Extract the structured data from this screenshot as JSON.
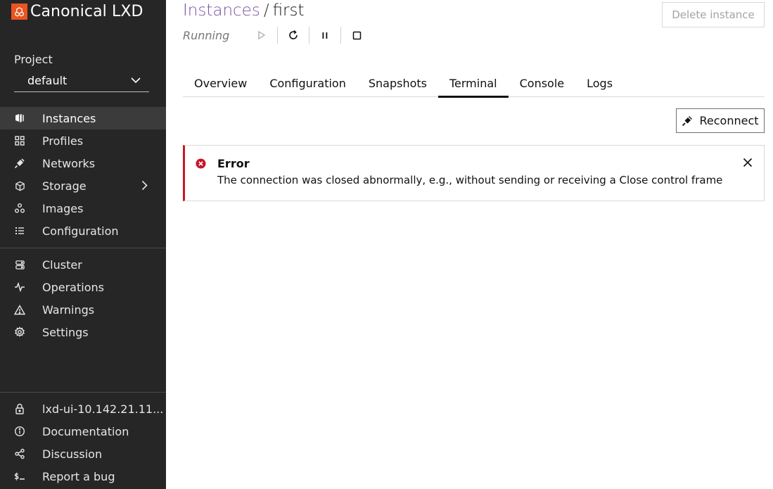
{
  "brand": {
    "name": "Canonical LXD"
  },
  "project": {
    "label": "Project",
    "selected": "default"
  },
  "nav": {
    "main": [
      {
        "label": "Instances",
        "icon": "instances-icon",
        "active": true
      },
      {
        "label": "Profiles",
        "icon": "profiles-icon"
      },
      {
        "label": "Networks",
        "icon": "networks-icon"
      },
      {
        "label": "Storage",
        "icon": "storage-icon",
        "expandable": true
      },
      {
        "label": "Images",
        "icon": "images-icon"
      },
      {
        "label": "Configuration",
        "icon": "configuration-icon"
      }
    ],
    "secondary": [
      {
        "label": "Cluster",
        "icon": "cluster-icon"
      },
      {
        "label": "Operations",
        "icon": "operations-icon"
      },
      {
        "label": "Warnings",
        "icon": "warning-icon"
      },
      {
        "label": "Settings",
        "icon": "settings-icon"
      }
    ],
    "footer": [
      {
        "label": "lxd-ui-10.142.21.11...",
        "icon": "lock-icon"
      },
      {
        "label": "Documentation",
        "icon": "info-icon"
      },
      {
        "label": "Discussion",
        "icon": "share-icon"
      },
      {
        "label": "Report a bug",
        "icon": "terminal-icon"
      }
    ]
  },
  "header": {
    "breadcrumb": "Instances",
    "separator": "/",
    "instance_name": "first",
    "status": "Running",
    "delete_label": "Delete instance"
  },
  "tabs": [
    {
      "label": "Overview"
    },
    {
      "label": "Configuration"
    },
    {
      "label": "Snapshots"
    },
    {
      "label": "Terminal",
      "active": true
    },
    {
      "label": "Console"
    },
    {
      "label": "Logs"
    }
  ],
  "terminal": {
    "reconnect_label": "Reconnect"
  },
  "alert": {
    "title": "Error",
    "message": "The connection was closed abnormally, e.g., without sending or receiving a Close control frame"
  },
  "colors": {
    "sidebar": "#262626",
    "accent": "#e95420",
    "error": "#c7162b",
    "link": "#7a4fa3"
  }
}
